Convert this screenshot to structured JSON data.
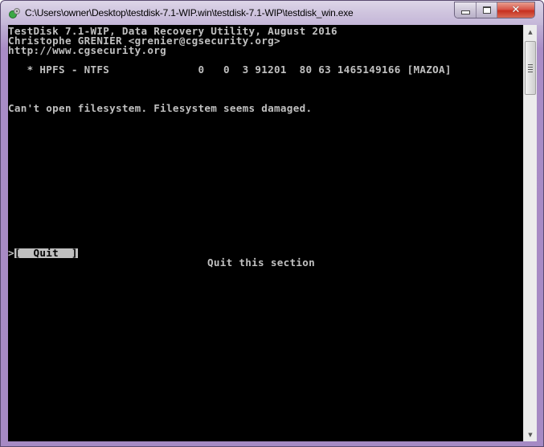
{
  "window": {
    "title": "C:\\Users\\owner\\Desktop\\testdisk-7.1-WIP.win\\testdisk-7.1-WIP\\testdisk_win.exe",
    "icon": "testdisk-app-icon",
    "caption_buttons": {
      "minimize": "minimize-icon",
      "maximize": "maximize-icon",
      "close": "close-icon",
      "close_glyph": "✕"
    }
  },
  "console": {
    "header_lines": [
      "TestDisk 7.1-WIP, Data Recovery Utility, August 2016",
      "Christophe GRENIER <grenier@cgsecurity.org>",
      "http://www.cgsecurity.org"
    ],
    "partition_line": "   * HPFS - NTFS              0   0  3 91201  80 63 1465149166 [MAZOA]",
    "partition": {
      "marker": "*",
      "type": "HPFS - NTFS",
      "start_cyl": "0",
      "start_head": "0",
      "start_sector": "3",
      "end_cyl": "91201",
      "end_head": "80",
      "end_sector": "63",
      "size_sectors": "1465149166",
      "label": "[MAZOA]"
    },
    "error_message": "Can't open filesystem. Filesystem seems damaged.",
    "menu": {
      "cursor": ">",
      "selected_button": "[  Quit  ]",
      "description": "Quit this section"
    }
  },
  "scrollbar": {
    "up_arrow": "▲",
    "down_arrow": "▼",
    "position_fraction": 0.0
  }
}
